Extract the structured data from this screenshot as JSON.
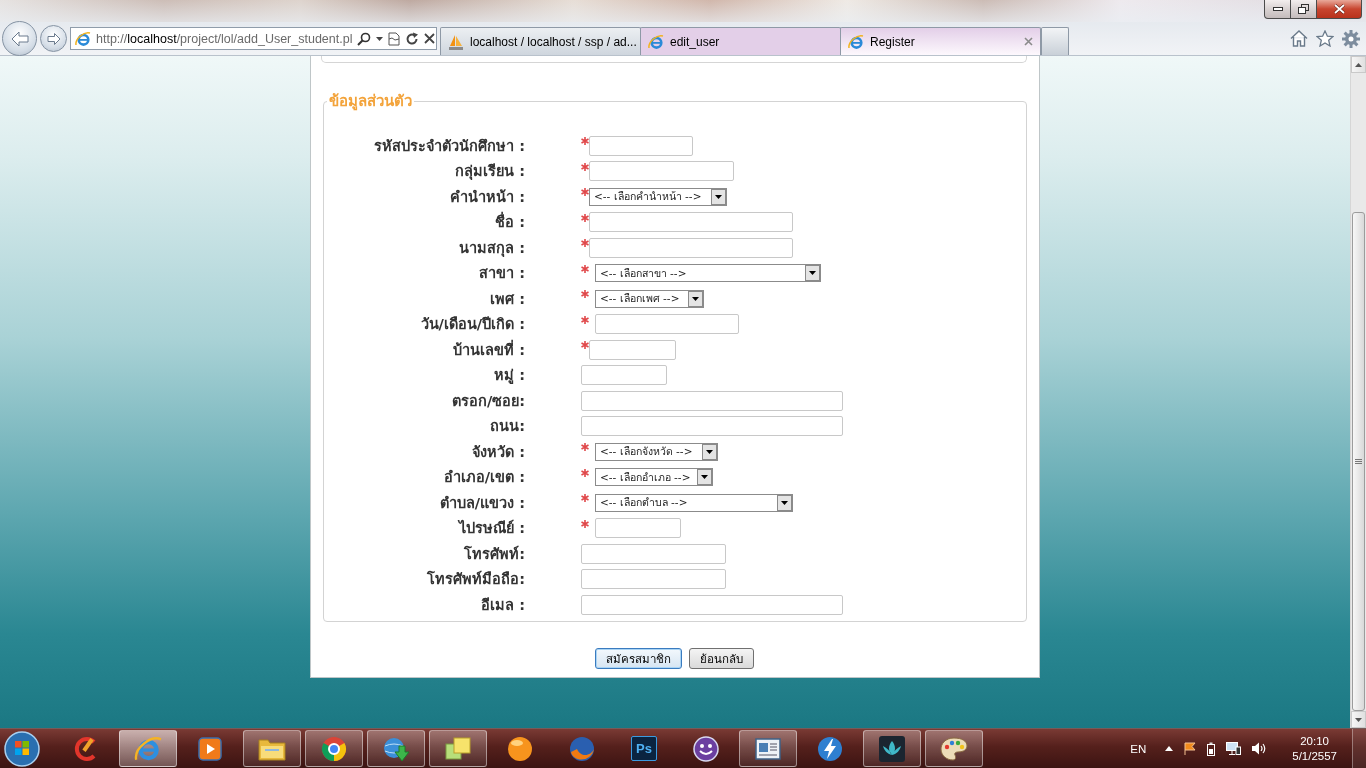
{
  "browser": {
    "address_bar": {
      "value": "http://**localhost**/project/lol/add_User_student.pl"
    },
    "tabs": [
      {
        "label": "localhost / localhost / ssp / ad...",
        "selected": false
      },
      {
        "label": "edit_user",
        "selected": false,
        "color": "#e3cfe8"
      },
      {
        "label": "Register",
        "selected": true,
        "color": "#e3cfe8"
      }
    ]
  },
  "form": {
    "legend": "ข้อมูลส่วนตัว",
    "fields": [
      {
        "label": "รหัสประจำตัวนักศึกษา :",
        "kind": "text",
        "required": true
      },
      {
        "label": "กลุ่มเรียน :",
        "kind": "text",
        "required": true
      },
      {
        "label": "คำนำหน้า :",
        "kind": "select",
        "required": true,
        "value": "<-- เลือกคำนำหน้า -->"
      },
      {
        "label": "ชื่อ :",
        "kind": "text",
        "required": true
      },
      {
        "label": "นามสกุล :",
        "kind": "text",
        "required": true
      },
      {
        "label": "สาขา :",
        "kind": "select",
        "required": true,
        "value": "<-- เลือกสาขา -->"
      },
      {
        "label": "เพศ :",
        "kind": "select",
        "required": true,
        "value": "<-- เลือกเพศ -->"
      },
      {
        "label": "วัน/เดือน/ปีเกิด :",
        "kind": "text",
        "required": true
      },
      {
        "label": "บ้านเลขที่ :",
        "kind": "text",
        "required": true
      },
      {
        "label": "หมู่ :",
        "kind": "text",
        "required": false
      },
      {
        "label": "ตรอก/ซอย:",
        "kind": "text",
        "required": false
      },
      {
        "label": "ถนน:",
        "kind": "text",
        "required": false
      },
      {
        "label": "จังหวัด :",
        "kind": "select",
        "required": true,
        "value": "<-- เลือกจังหวัด -->"
      },
      {
        "label": "อำเภอ/เขต :",
        "kind": "select",
        "required": true,
        "value": "<-- เลือกอำเภอ -->"
      },
      {
        "label": "ตำบล/แขวง :",
        "kind": "select",
        "required": true,
        "value": "<-- เลือกตำบล -->"
      },
      {
        "label": "ไปรษณีย์ :",
        "kind": "text",
        "required": true
      },
      {
        "label": "โทรศัพท์:",
        "kind": "text",
        "required": false
      },
      {
        "label": "โทรศัพท์มือถือ:",
        "kind": "text",
        "required": false
      },
      {
        "label": "อีเมล :",
        "kind": "text",
        "required": false
      }
    ]
  },
  "buttons": [
    {
      "label": "สมัครสมาชิก",
      "focused": true
    },
    {
      "label": "ย้อนกลับ",
      "focused": false
    }
  ],
  "taskbar": {
    "apps": [
      {
        "running": false,
        "selected": false
      },
      {
        "running": true,
        "selected": true
      },
      {
        "running": false,
        "selected": false
      },
      {
        "running": true,
        "selected": false
      },
      {
        "running": true,
        "selected": false
      },
      {
        "running": true,
        "selected": false
      },
      {
        "running": true,
        "selected": false
      },
      {
        "running": false,
        "selected": false
      },
      {
        "running": false,
        "selected": false
      },
      {
        "running": false,
        "selected": false,
        "label": "Ps"
      },
      {
        "running": false,
        "selected": false
      },
      {
        "running": true,
        "selected": false
      },
      {
        "running": false,
        "selected": false
      },
      {
        "running": true,
        "selected": false
      },
      {
        "running": true,
        "selected": false
      }
    ],
    "language": "EN",
    "time": "20:10",
    "date": "5/1/2557"
  }
}
